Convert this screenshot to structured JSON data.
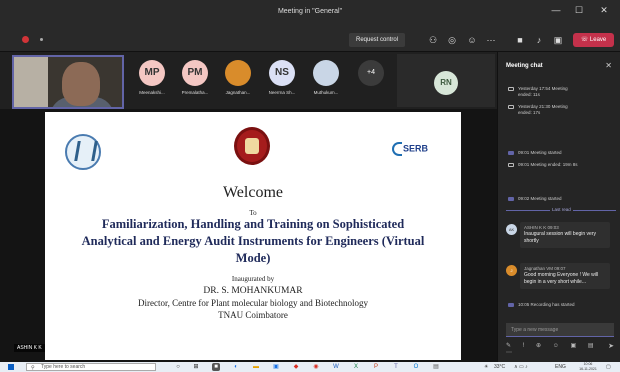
{
  "window": {
    "title": "Meeting in \"General\"",
    "controls": [
      "—",
      "☐",
      "✕"
    ]
  },
  "toolbar": {
    "request_control": "Request control",
    "leave": "Leave",
    "icons": [
      "people-icon",
      "chat-icon",
      "reactions-icon",
      "more-icon",
      "camera-icon",
      "mic-off-icon",
      "share-icon"
    ]
  },
  "gallery": {
    "self_label": "ASHIN K K",
    "participants": [
      {
        "initials": "MP",
        "name": "Meenakshi...",
        "color": "#f4c7c3"
      },
      {
        "initials": "PM",
        "name": "Premalatha...",
        "color": "#f4c7c3"
      },
      {
        "initials": "",
        "name": "Jagnathan...",
        "color": "#d98c2b"
      },
      {
        "initials": "NS",
        "name": "Neerrna Sh...",
        "color": "#dbe0f5"
      },
      {
        "initials": "",
        "name": "Muthukum...",
        "color": "#c9d6e6"
      }
    ],
    "more_count": "+4",
    "rn_initials": "RN"
  },
  "slide": {
    "welcome": "Welcome",
    "to": "To",
    "title_line1": "Familiarization, Handling and Training on Sophisticated",
    "title_line2": "Analytical and Energy Audit Instruments for Engineers (Virtual",
    "title_line3": "Mode)",
    "inaugurated_by": "Inaugurated by",
    "speaker": "DR. S. MOHANKUMAR",
    "designation": "Director, Centre for Plant molecular biology and Biotechnology",
    "institution": "TNAU Coimbatore",
    "serb_logo_text": "SERB"
  },
  "chat": {
    "header": "Meeting chat",
    "events": [
      {
        "line1": "Yesterday 17:54  Meeting",
        "line2": "ended: 11s"
      },
      {
        "line1": "Yesterday 21:30  Meeting",
        "line2": "ended: 17s"
      },
      {
        "line1": "09:01  Meeting started",
        "line2": ""
      },
      {
        "line1": "09:01  Meeting ended: 19m 8s",
        "line2": ""
      },
      {
        "line1": "09:02  Meeting started",
        "line2": ""
      }
    ],
    "last_read": "Last read",
    "messages": [
      {
        "initials": "AK",
        "who": "ASHIN K K  09:03",
        "text": "Inaugural session will begin very shortly",
        "color": "#c9d6e6"
      },
      {
        "initials": "J",
        "who": "Jagnathan VM  09:07",
        "text": "Good morning Everyone ! We will begin in a very short while...",
        "color": "#d98c2b"
      }
    ],
    "recording": "10:05  Recording has started",
    "compose_placeholder": "Type a new message",
    "compose_icons": "✎ ! ⊕ ☺ ▣ ▤ ⋯",
    "send_icon": "➤"
  },
  "taskbar": {
    "search_placeholder": "Type here to search",
    "tray_weather": "33°C",
    "tray_lang": "ENG",
    "time": "10:06",
    "date": "16-11-2021"
  }
}
